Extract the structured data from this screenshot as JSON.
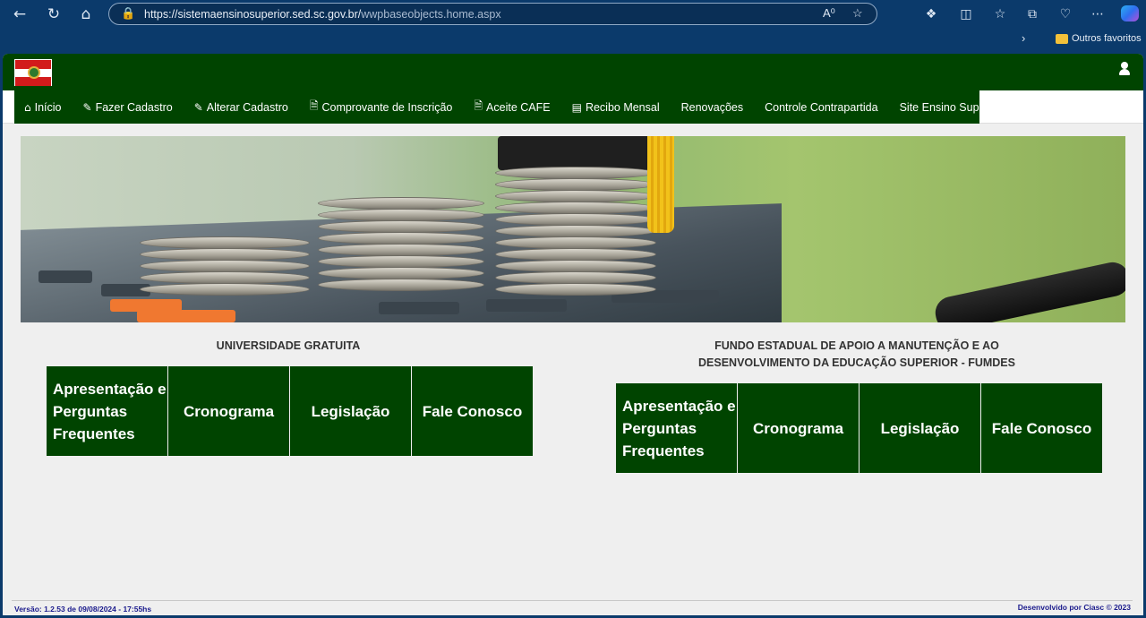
{
  "browser": {
    "url_main": "https://sistemaensinosuperior.sed.sc.gov.br/",
    "url_path": "wwpbaseobjects.home.aspx",
    "favorites_label": "Outros favoritos",
    "icons": [
      "back-icon",
      "refresh-icon",
      "home-icon",
      "lock-icon",
      "read-aloud-icon",
      "favorite-star-icon",
      "extensions-icon",
      "split-screen-icon",
      "favorites-icon",
      "collections-icon",
      "browser-essentials-icon",
      "more-icon",
      "copilot-icon"
    ]
  },
  "menu": {
    "items": [
      {
        "label": "Início",
        "icon": "home-icon"
      },
      {
        "label": "Fazer Cadastro",
        "icon": "edit-icon"
      },
      {
        "label": "Alterar Cadastro",
        "icon": "edit-icon"
      },
      {
        "label": "Comprovante de Inscrição",
        "icon": "pdf-icon"
      },
      {
        "label": "Aceite CAFE",
        "icon": "document-icon"
      },
      {
        "label": "Recibo Mensal",
        "icon": "card-icon"
      },
      {
        "label": "Renovações",
        "icon": ""
      },
      {
        "label": "Controle Contrapartida",
        "icon": ""
      },
      {
        "label": "Site Ensino Superior",
        "icon": ""
      }
    ]
  },
  "sections": {
    "left": {
      "title": "UNIVERSIDADE GRATUITA",
      "tiles": [
        "Apresentação e Perguntas Frequentes",
        "Cronograma",
        "Legislação",
        "Fale Conosco"
      ]
    },
    "right": {
      "title_line1": "FUNDO ESTADUAL DE APOIO A MANUTENÇÃO E AO",
      "title_line2": "DESENVOLVIMENTO DA EDUCAÇÃO SUPERIOR - FUMDES",
      "tiles": [
        "Apresentação e Perguntas Frequentes",
        "Cronograma",
        "Legislação",
        "Fale Conosco"
      ]
    }
  },
  "footer": {
    "version": "Versão: 1.2.53 de 09/08/2024 - 17:55hs",
    "developer": "Desenvolvido por Ciasc © 2023"
  },
  "colors": {
    "brand_green": "#004400",
    "browser_blue": "#0b3a6b",
    "footer_text": "#1a1a8c"
  }
}
